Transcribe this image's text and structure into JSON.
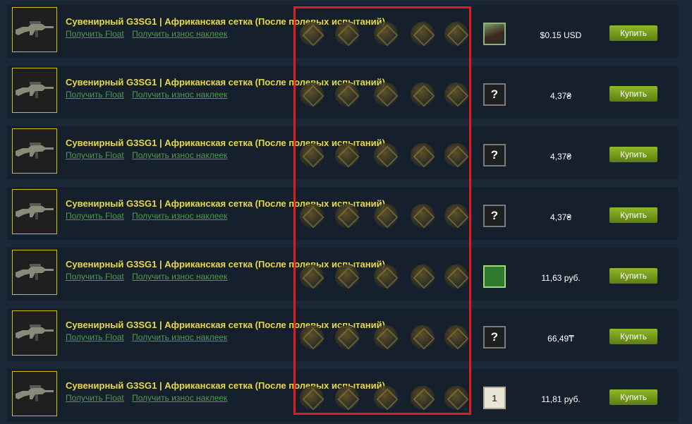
{
  "listings": [
    {
      "title": "Сувенирный G3SG1 | Африканская сетка (После полевых испытаний)",
      "float_link": "Получить Float",
      "wear_link": "Получить износ наклеек",
      "avatar": "photo",
      "avatar_text": "",
      "price": "$0.15 USD",
      "buy_label": "Купить"
    },
    {
      "title": "Сувенирный G3SG1 | Африканская сетка (После полевых испытаний)",
      "float_link": "Получить Float",
      "wear_link": "Получить износ наклеек",
      "avatar": "question",
      "avatar_text": "?",
      "price": "4,37₴",
      "buy_label": "Купить"
    },
    {
      "title": "Сувенирный G3SG1 | Африканская сетка (После полевых испытаний)",
      "float_link": "Получить Float",
      "wear_link": "Получить износ наклеек",
      "avatar": "question",
      "avatar_text": "?",
      "price": "4,37₴",
      "buy_label": "Купить"
    },
    {
      "title": "Сувенирный G3SG1 | Африканская сетка (После полевых испытаний)",
      "float_link": "Получить Float",
      "wear_link": "Получить износ наклеек",
      "avatar": "question",
      "avatar_text": "?",
      "price": "4,37₴",
      "buy_label": "Купить"
    },
    {
      "title": "Сувенирный G3SG1 | Африканская сетка (После полевых испытаний)",
      "float_link": "Получить Float",
      "wear_link": "Получить износ наклеек",
      "avatar": "pixel",
      "avatar_text": "",
      "price": "11,63 руб.",
      "buy_label": "Купить"
    },
    {
      "title": "Сувенирный G3SG1 | Африканская сетка (После полевых испытаний)",
      "float_link": "Получить Float",
      "wear_link": "Получить износ наклеек",
      "avatar": "question",
      "avatar_text": "?",
      "price": "66,49₸",
      "buy_label": "Купить"
    },
    {
      "title": "Сувенирный G3SG1 | Африканская сетка (После полевых испытаний)",
      "float_link": "Получить Float",
      "wear_link": "Получить износ наклеек",
      "avatar": "badge",
      "avatar_text": "1",
      "price": "11,81 руб.",
      "buy_label": "Купить"
    }
  ],
  "colors": {
    "background": "#1b2838",
    "row_background": "#16202d",
    "title": "#e8d84a",
    "link": "#4d9a4d",
    "buy_button": "#75a21c",
    "highlight": "#e01b24",
    "thumb_border": "#d2c000"
  },
  "icons": {
    "weapon": "rifle-icon",
    "sticker": "sticker-icon"
  }
}
